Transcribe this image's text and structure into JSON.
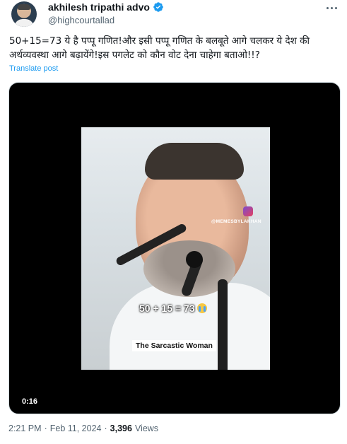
{
  "author": {
    "name": "akhilesh tripathi advo",
    "handle": "@highcourtallad",
    "verified_icon": "verified-badge-icon",
    "verified_color": "#1d9bf0"
  },
  "post": {
    "text": "50+15=73 ये है पप्पू गणित!और इसी पप्पू गणित के बलबूते आगे चलकर ये देश की अर्थव्यवस्था आगे बढ़ायेंगे!इस पगलेट को कौन वोट देना चाहेगा बताओ!!?",
    "translate_label": "Translate post"
  },
  "media": {
    "watermark": "@MEMESBYLAKHAN",
    "caption": "50 + 15 = 73",
    "caption_emoji": "crying-face-icon",
    "credit": "The Sarcastic Woman",
    "duration": "0:16"
  },
  "meta": {
    "time": "2:21 PM",
    "separator1": "·",
    "date": "Feb 11, 2024",
    "separator2": "·",
    "views_count": "3,396",
    "views_label": "Views"
  },
  "colors": {
    "accent": "#1d9bf0",
    "muted": "#536471",
    "text": "#0f1419"
  }
}
